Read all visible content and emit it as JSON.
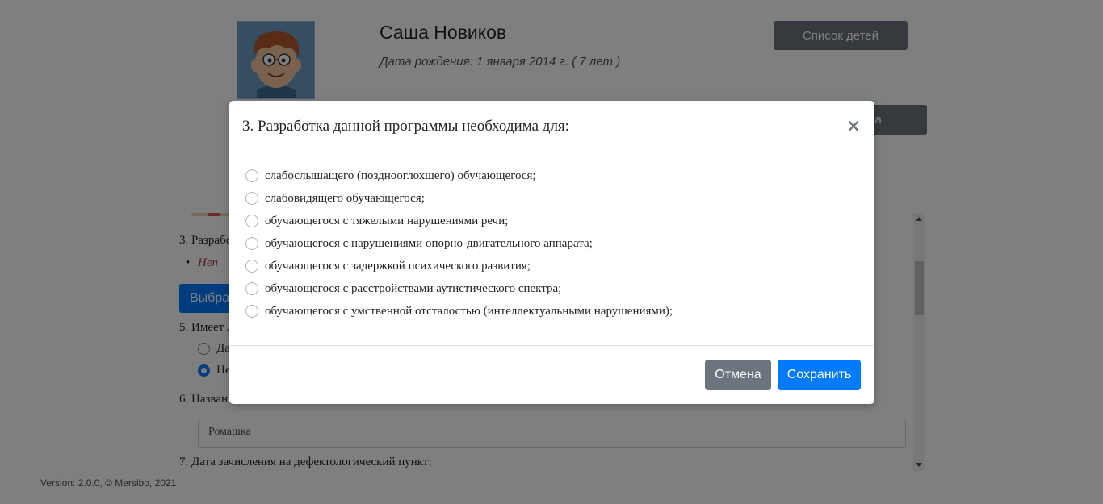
{
  "profile": {
    "name": "Саша Новиков",
    "birth": "Дата рождения: 1 января 2014 г. ( 7 лет )",
    "children_list_button": "Список детей",
    "hidden_button_tail": "а",
    "avatar_icon": "boy-cartoon-avatar-icon"
  },
  "form": {
    "q3_label": "3. Разрабо",
    "q3_answer": "Неп",
    "choose_button": "Выбрат",
    "q5_label": "5. Имеет л",
    "q5_option_yes": "Да",
    "q5_option_no": "Не",
    "q6_label": "6. Назван",
    "q6_value": "Ромашка",
    "q7_label": "7. Дата зачисления на дефектологический пункт:"
  },
  "footer": {
    "version": "Version: 2.0.0, © Mersibo, 2021"
  },
  "modal": {
    "title": "3. Разработка данной программы необходима для:",
    "close_symbol": "×",
    "options": [
      "слабослышащего (позднооглохшего) обучающегося;",
      "слабовидящего обучающегося;",
      "обучающегося с тяжелыми нарушениями речи;",
      "обучающегося с нарушениями опорно-двигательного аппарата;",
      "обучающегося с задержкой психического развития;",
      "обучающегося с расстройствами аутистического спектра;",
      "обучающегося с умственной отсталостью (интеллектуальными нарушениями);"
    ],
    "cancel_label": "Отмена",
    "save_label": "Сохранить"
  },
  "colors": {
    "primary": "#007bff",
    "secondary": "#6c757d",
    "overlay": "rgba(0,0,0,0.5)"
  }
}
